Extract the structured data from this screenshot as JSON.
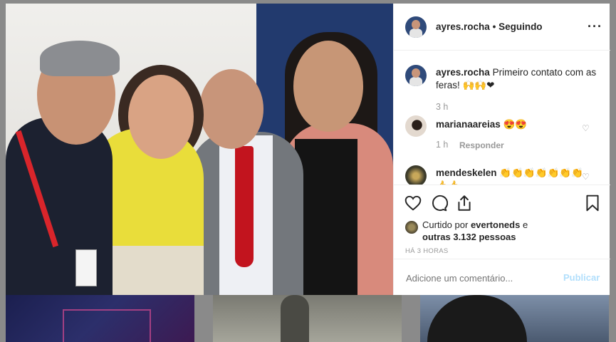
{
  "post": {
    "username": "ayres.rocha",
    "follow_status": "Seguindo",
    "more_glyph": "···",
    "caption": {
      "username": "ayres.rocha",
      "text": "Primeiro contato com as feras! 🙌🙌❤",
      "time": "3 h"
    },
    "comments": [
      {
        "username": "marianaareias",
        "text": "😍😍",
        "time": "1 h",
        "reply_label": "Responder"
      },
      {
        "username": "mendeskelen",
        "text": "👏👏👏👏👏👏👏👍👍"
      }
    ],
    "actions": {
      "like_icon": "heart-icon",
      "comment_icon": "comment-icon",
      "share_icon": "share-icon",
      "save_icon": "bookmark-icon"
    },
    "likes": {
      "prefix": "Curtido por",
      "user": "evertoneds",
      "connector": "e",
      "others": "outras 3.132 pessoas"
    },
    "posted_ago": "HÁ 3 HORAS",
    "add_comment": {
      "placeholder": "Adicione um comentário...",
      "publish_label": "Publicar"
    }
  }
}
